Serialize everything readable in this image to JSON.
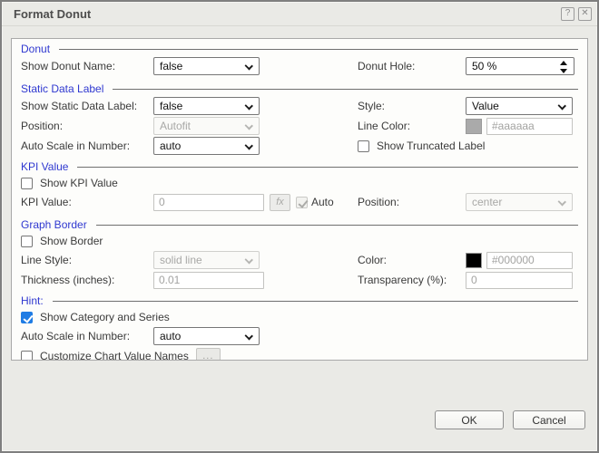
{
  "dialog": {
    "title": "Format Donut",
    "help_glyph": "?",
    "close_glyph": "✕"
  },
  "colors": {
    "section_blue": "#2f38d0",
    "checkbox_accent": "#1f7ce4",
    "line_color_swatch": "#aaaaaa",
    "border_color_swatch": "#000000"
  },
  "donut": {
    "legend": "Donut",
    "show_name_label": "Show Donut Name:",
    "show_name_value": "false",
    "hole_label": "Donut Hole:",
    "hole_value": "50 %"
  },
  "static_label": {
    "legend": "Static Data Label",
    "show_label": "Show Static Data Label:",
    "show_value": "false",
    "style_label": "Style:",
    "style_value": "Value",
    "position_label": "Position:",
    "position_value": "Autofit",
    "line_color_label": "Line Color:",
    "line_color_value": "#aaaaaa",
    "autoscale_label": "Auto Scale in Number:",
    "autoscale_value": "auto",
    "truncated_label": "Show Truncated Label"
  },
  "kpi": {
    "legend": "KPI Value",
    "show_label": "Show KPI Value",
    "value_label": "KPI Value:",
    "value": "0",
    "fx_label": "fx",
    "auto_label": "Auto",
    "position_label": "Position:",
    "position_value": "center"
  },
  "graph_border": {
    "legend": "Graph Border",
    "show_label": "Show Border",
    "line_style_label": "Line Style:",
    "line_style_value": "solid line",
    "color_label": "Color:",
    "color_value": "#000000",
    "thickness_label": "Thickness (inches):",
    "thickness_value": "0.01",
    "transparency_label": "Transparency (%):",
    "transparency_value": "0"
  },
  "hint": {
    "legend": "Hint:",
    "show_category_label": "Show Category and Series",
    "autoscale_label": "Auto Scale in Number:",
    "autoscale_value": "auto",
    "customize_label": "Customize Chart Value Names",
    "more_label": "..."
  },
  "footer": {
    "ok": "OK",
    "cancel": "Cancel"
  }
}
